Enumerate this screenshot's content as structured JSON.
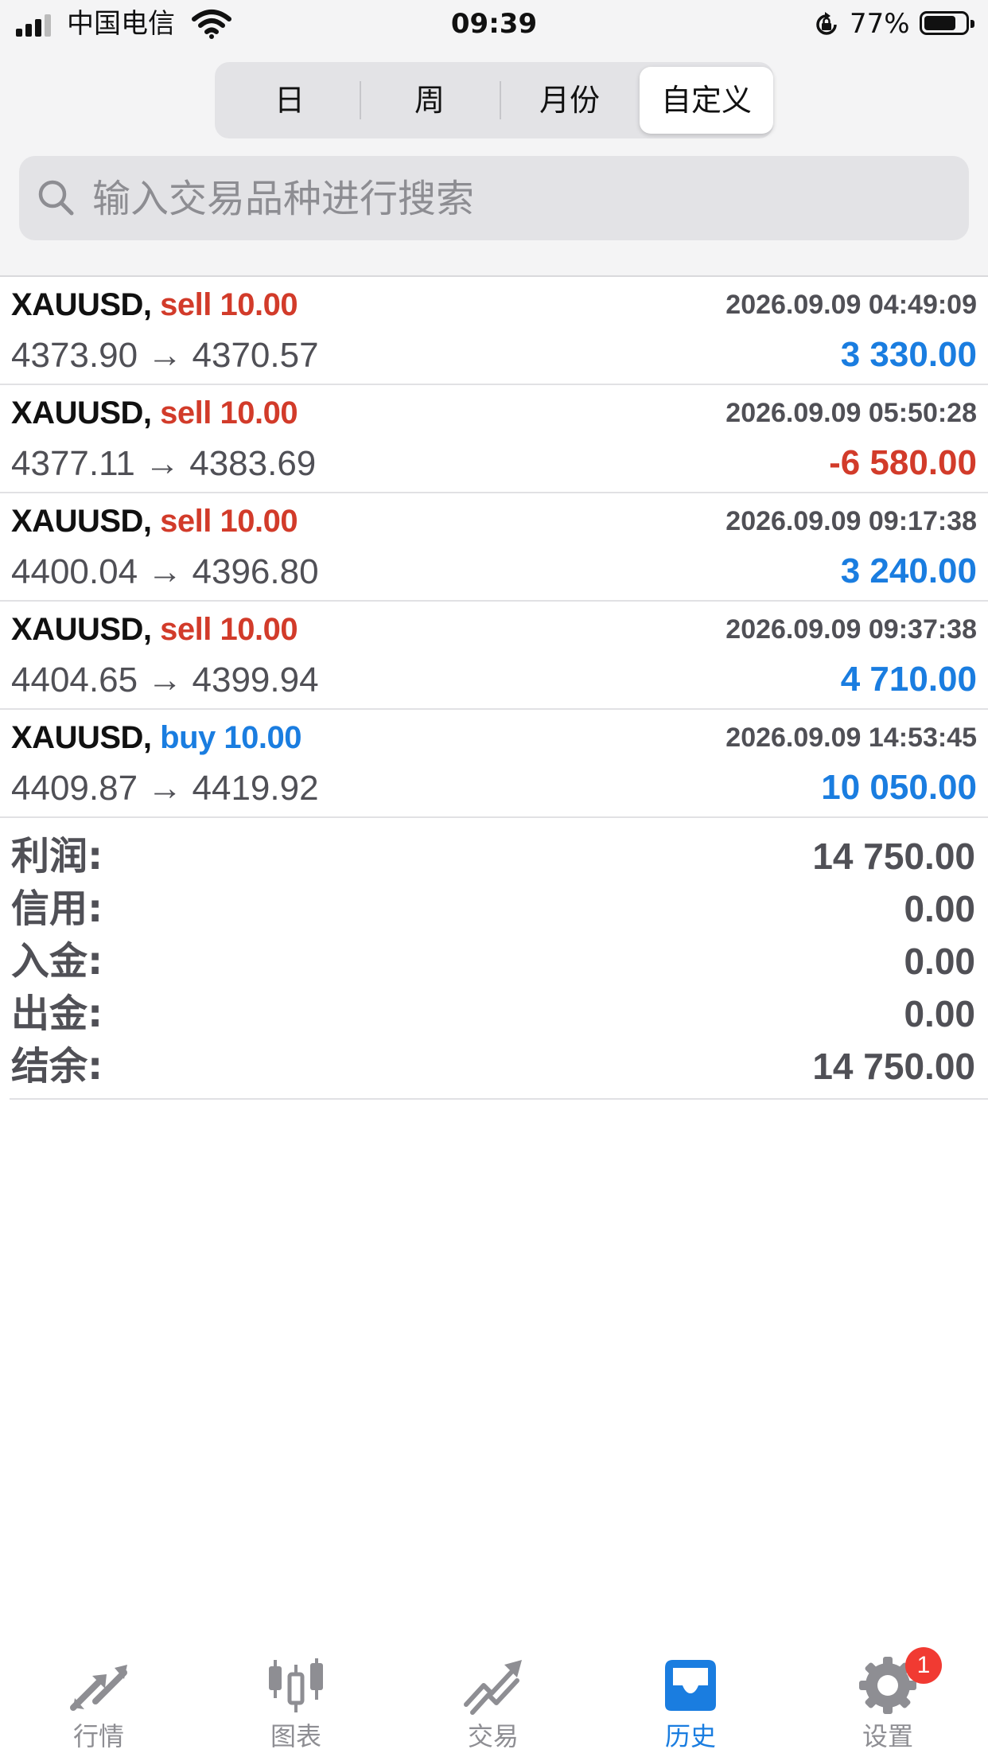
{
  "status_bar": {
    "carrier": "中国电信",
    "time": "09:39",
    "battery_percent": "77%",
    "battery_level": 0.77,
    "icons": [
      "signal-icon",
      "wifi-icon",
      "rotation-lock-icon",
      "battery-icon"
    ]
  },
  "period_tabs": [
    {
      "label": "日",
      "active": false
    },
    {
      "label": "周",
      "active": false
    },
    {
      "label": "月份",
      "active": false
    },
    {
      "label": "自定义",
      "active": true
    }
  ],
  "search": {
    "placeholder": "输入交易品种进行搜索",
    "value": "",
    "icon": "search-icon"
  },
  "trades": [
    {
      "symbol": "XAUUSD,",
      "side": "sell 10.00",
      "time": "2026.09.09 04:49:09",
      "prices": "4373.90 → 4370.57",
      "profit": "3 330.00"
    },
    {
      "symbol": "XAUUSD,",
      "side": "sell 10.00",
      "time": "2026.09.09 05:50:28",
      "prices": "4377.11 → 4383.69",
      "profit": "-6 580.00"
    },
    {
      "symbol": "XAUUSD,",
      "side": "sell 10.00",
      "time": "2026.09.09 09:17:38",
      "prices": "4400.04 → 4396.80",
      "profit": "3 240.00"
    },
    {
      "symbol": "XAUUSD,",
      "side": "sell 10.00",
      "time": "2026.09.09 09:37:38",
      "prices": "4404.65 → 4399.94",
      "profit": "4 710.00"
    },
    {
      "symbol": "XAUUSD,",
      "side": "buy 10.00",
      "time": "2026.09.09 14:53:45",
      "prices": "4409.87 → 4419.92",
      "profit": "10 050.00"
    }
  ],
  "summary": [
    {
      "label": "利润:",
      "value": "14 750.00"
    },
    {
      "label": "信用:",
      "value": "0.00"
    },
    {
      "label": "入金:",
      "value": "0.00"
    },
    {
      "label": "出金:",
      "value": "0.00"
    },
    {
      "label": "结余:",
      "value": "14 750.00"
    }
  ],
  "tab_bar": [
    {
      "label": "行情",
      "icon": "quotes-arrows-icon",
      "active": false
    },
    {
      "label": "图表",
      "icon": "candlestick-chart-icon",
      "active": false
    },
    {
      "label": "交易",
      "icon": "trade-trend-icon",
      "active": false
    },
    {
      "label": "历史",
      "icon": "history-inbox-icon",
      "active": true
    },
    {
      "label": "设置",
      "icon": "settings-gear-icon",
      "active": false,
      "badge": "1"
    }
  ],
  "colors": {
    "sell": "#d23b2a",
    "buy": "#1a7de0",
    "profit_positive": "#1a7de0",
    "profit_negative": "#d23b2a",
    "tab_active": "#1a7de0",
    "tab_inactive": "#8e8e93",
    "badge": "#f13a32"
  }
}
